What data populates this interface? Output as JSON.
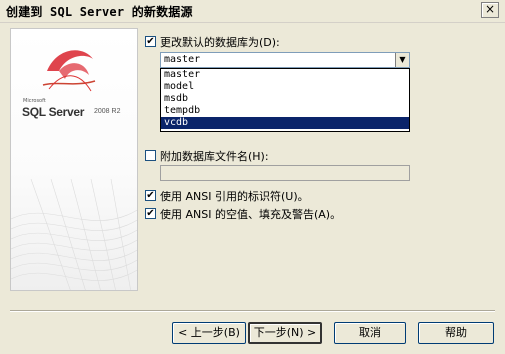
{
  "window": {
    "title": "创建到 SQL Server 的新数据源",
    "close_label": "×"
  },
  "branding": {
    "microsoft": "Microsoft",
    "product": "SQL Server",
    "version": "2008 R2"
  },
  "default_db": {
    "checked": true,
    "label": "更改默认的数据库为(D):",
    "selected_value": "master",
    "options": [
      "master",
      "model",
      "msdb",
      "tempdb",
      "vcdb"
    ],
    "highlighted_option": "vcdb"
  },
  "attach_db": {
    "checked": false,
    "label": "附加数据库文件名(H):",
    "value": ""
  },
  "ansi_quoted": {
    "checked": true,
    "label": "使用 ANSI 引用的标识符(U)。"
  },
  "ansi_nulls": {
    "checked": true,
    "label": "使用 ANSI 的空值、填充及警告(A)。"
  },
  "buttons": {
    "back": "< 上一步(B)",
    "next": "下一步(N) >",
    "cancel": "取消",
    "help": "帮助"
  }
}
